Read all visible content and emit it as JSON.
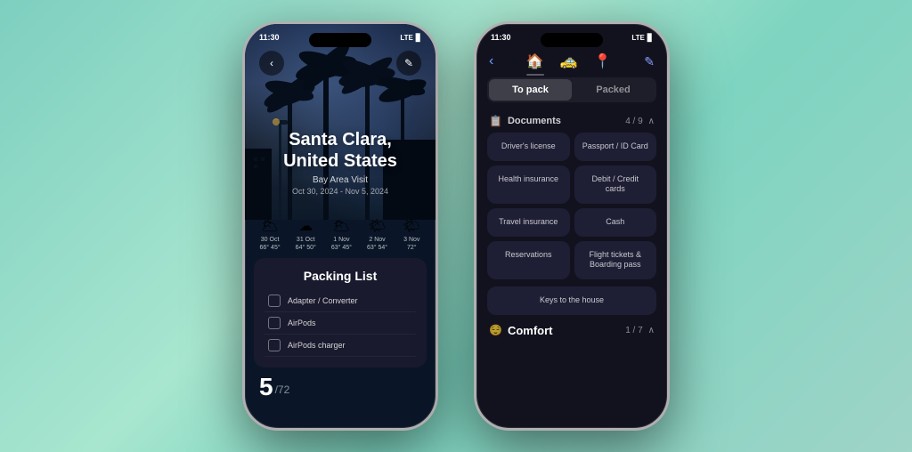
{
  "background": {
    "gradient_start": "#7ecfc0",
    "gradient_end": "#9fd4c8"
  },
  "phone1": {
    "status_bar": {
      "time": "11:30",
      "signal": "LTE",
      "battery": "●"
    },
    "header": {
      "back_label": "‹",
      "edit_label": "✎"
    },
    "hero": {
      "city": "Santa Clara,",
      "country": "United States",
      "trip_name": "Bay Area Visit",
      "dates": "Oct 30, 2024 - Nov 5, 2024"
    },
    "weather": [
      {
        "date": "30 Oct",
        "temp": "66° 45°",
        "icon": "🌥"
      },
      {
        "date": "31 Oct",
        "temp": "64° 50°",
        "icon": "☁"
      },
      {
        "date": "1 Nov",
        "temp": "63° 45°",
        "icon": "🌥"
      },
      {
        "date": "2 Nov",
        "temp": "63° 54°",
        "icon": "🌤"
      },
      {
        "date": "3 Nov",
        "temp": "72°",
        "icon": "🌤"
      }
    ],
    "packing_list": {
      "title": "Packing List",
      "items": [
        {
          "label": "Adapter / Converter"
        },
        {
          "label": "AirPods"
        },
        {
          "label": "AirPods charger"
        }
      ],
      "count": "5",
      "total": "72"
    }
  },
  "phone2": {
    "status_bar": {
      "time": "11:30",
      "signal": "LTE",
      "battery": "●"
    },
    "nav": {
      "back_label": "‹",
      "icons": [
        "🏠",
        "🚕",
        "📍"
      ],
      "edit_label": "✎"
    },
    "tabs": [
      {
        "label": "To pack",
        "active": true
      },
      {
        "label": "Packed",
        "active": false
      }
    ],
    "sections": [
      {
        "id": "documents",
        "icon": "📄",
        "label": "Documents",
        "count": "4 / 9",
        "chevron": "∧",
        "items": [
          {
            "label": "Driver's license"
          },
          {
            "label": "Passport / ID Card"
          },
          {
            "label": "Health insurance"
          },
          {
            "label": "Debit / Credit cards"
          },
          {
            "label": "Travel insurance"
          },
          {
            "label": "Cash"
          },
          {
            "label": "Reservations"
          },
          {
            "label": "Flight tickets & Boarding pass"
          },
          {
            "label": "Keys to the house"
          }
        ]
      },
      {
        "id": "comfort",
        "icon": "😌",
        "label": "Comfort",
        "count": "1 / 7",
        "chevron": "∧"
      }
    ]
  }
}
